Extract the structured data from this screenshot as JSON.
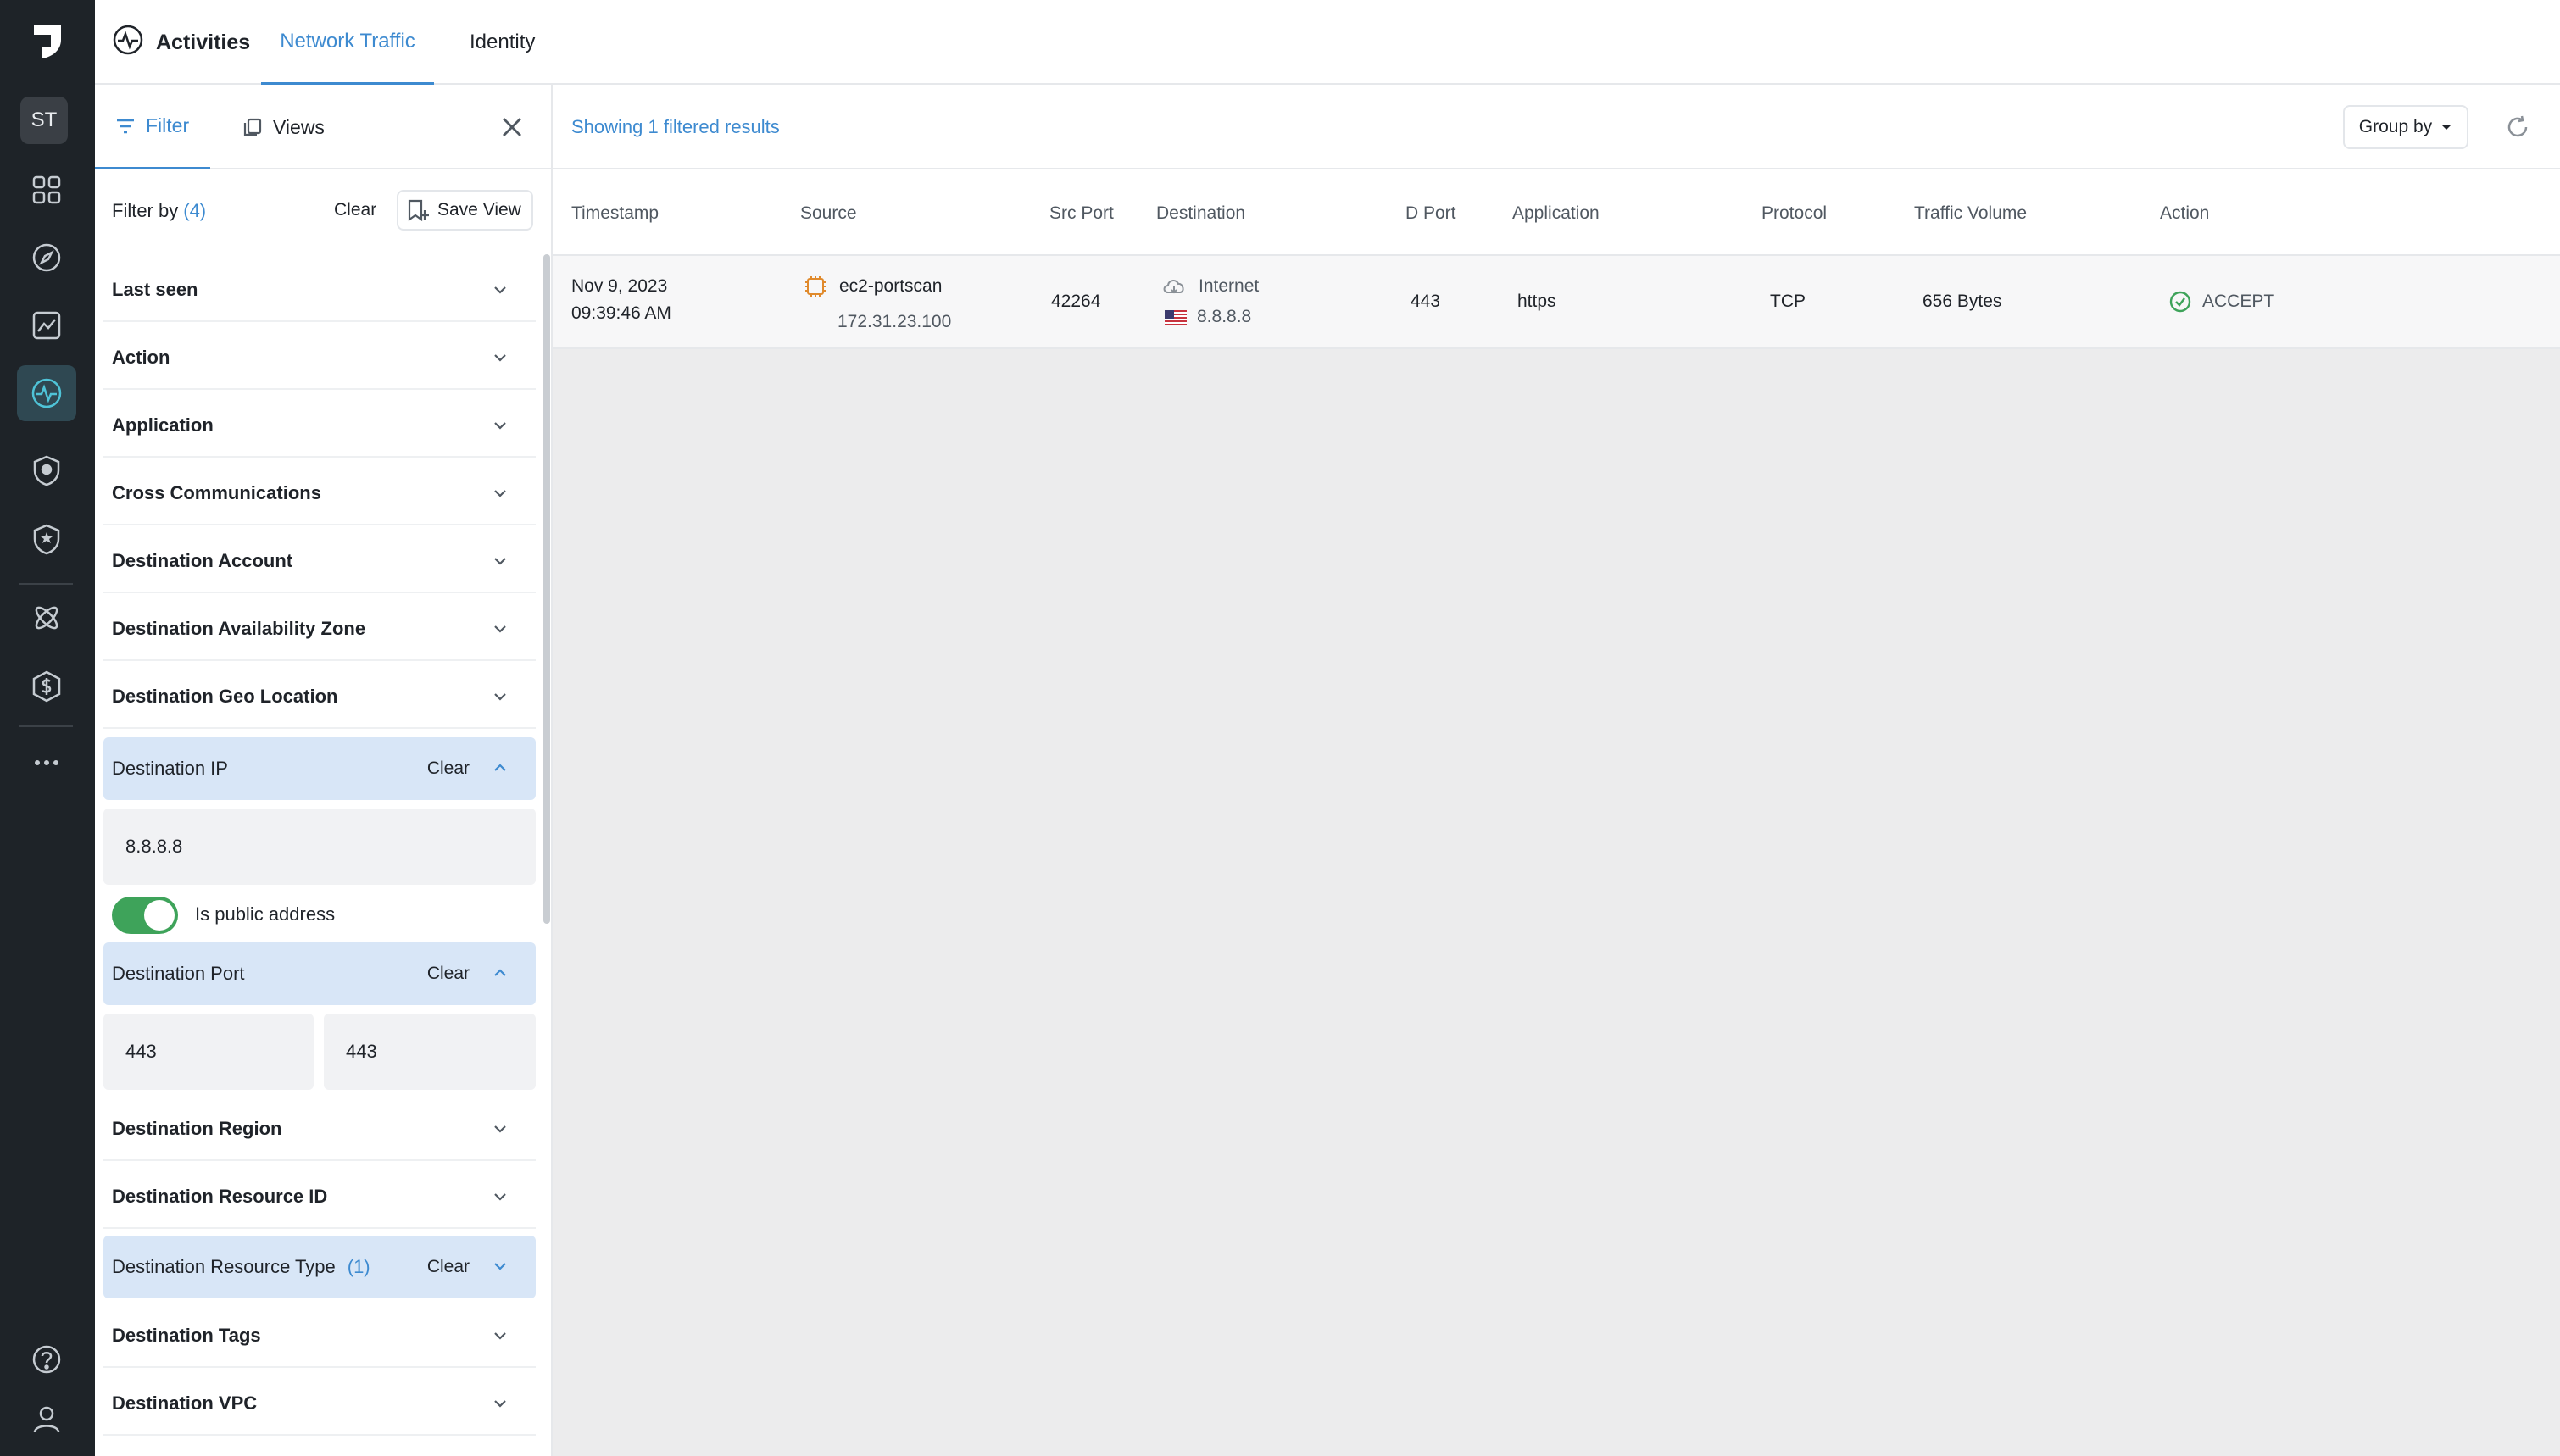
{
  "rail": {
    "avatar": "ST",
    "items": [
      "dashboard-icon",
      "compass-icon",
      "chart-icon",
      "activity-icon",
      "shield-icon",
      "shield-star-icon",
      "atom-icon",
      "dollar-icon",
      "more-icon"
    ],
    "bottom": [
      "help-icon",
      "user-icon"
    ]
  },
  "header": {
    "title": "Activities",
    "tabs": [
      {
        "label": "Network Traffic",
        "active": true
      },
      {
        "label": "Identity",
        "active": false
      }
    ]
  },
  "filter_panel": {
    "tabs": [
      {
        "label": "Filter",
        "active": true
      },
      {
        "label": "Views",
        "active": false
      }
    ],
    "filter_by_label": "Filter by",
    "filter_count": "(4)",
    "clear_label": "Clear",
    "save_view_label": "Save View",
    "rows": [
      {
        "label": "Last seen"
      },
      {
        "label": "Action"
      },
      {
        "label": "Application"
      },
      {
        "label": "Cross Communications"
      },
      {
        "label": "Destination Account"
      },
      {
        "label": "Destination Availability Zone"
      },
      {
        "label": "Destination Geo Location"
      },
      {
        "label": "Destination IP",
        "clear": "Clear"
      },
      {
        "label": "Destination Port",
        "clear": "Clear"
      },
      {
        "label": "Destination Region"
      },
      {
        "label": "Destination Resource ID"
      },
      {
        "label": "Destination Resource Type",
        "count": "(1)",
        "clear": "Clear"
      },
      {
        "label": "Destination Tags"
      },
      {
        "label": "Destination VPC"
      }
    ],
    "destination_ip_value": "8.8.8.8",
    "is_public_label": "Is public address",
    "is_public_on": true,
    "port_from": "443",
    "port_to": "443"
  },
  "results": {
    "summary": "Showing 1 filtered results",
    "group_by_label": "Group by"
  },
  "table": {
    "columns": [
      "Timestamp",
      "Source",
      "Src Port",
      "Destination",
      "D Port",
      "Application",
      "Protocol",
      "Traffic Volume",
      "Action"
    ],
    "rows": [
      {
        "date": "Nov 9, 2023",
        "time": "09:39:46 AM",
        "source_name": "ec2-portscan",
        "source_ip": "172.31.23.100",
        "src_port": "42264",
        "dest_name": "Internet",
        "dest_ip": "8.8.8.8",
        "d_port": "443",
        "application": "https",
        "protocol": "TCP",
        "traffic_volume": "656 Bytes",
        "action": "ACCEPT"
      }
    ]
  },
  "colors": {
    "accent": "#3d8ad0",
    "rail_bg": "#1e2328",
    "toggle_on": "#3ea35a",
    "selected_row": "#d8e6f7",
    "accept_green": "#3ea35a",
    "ec2_orange": "#e08a2c"
  }
}
